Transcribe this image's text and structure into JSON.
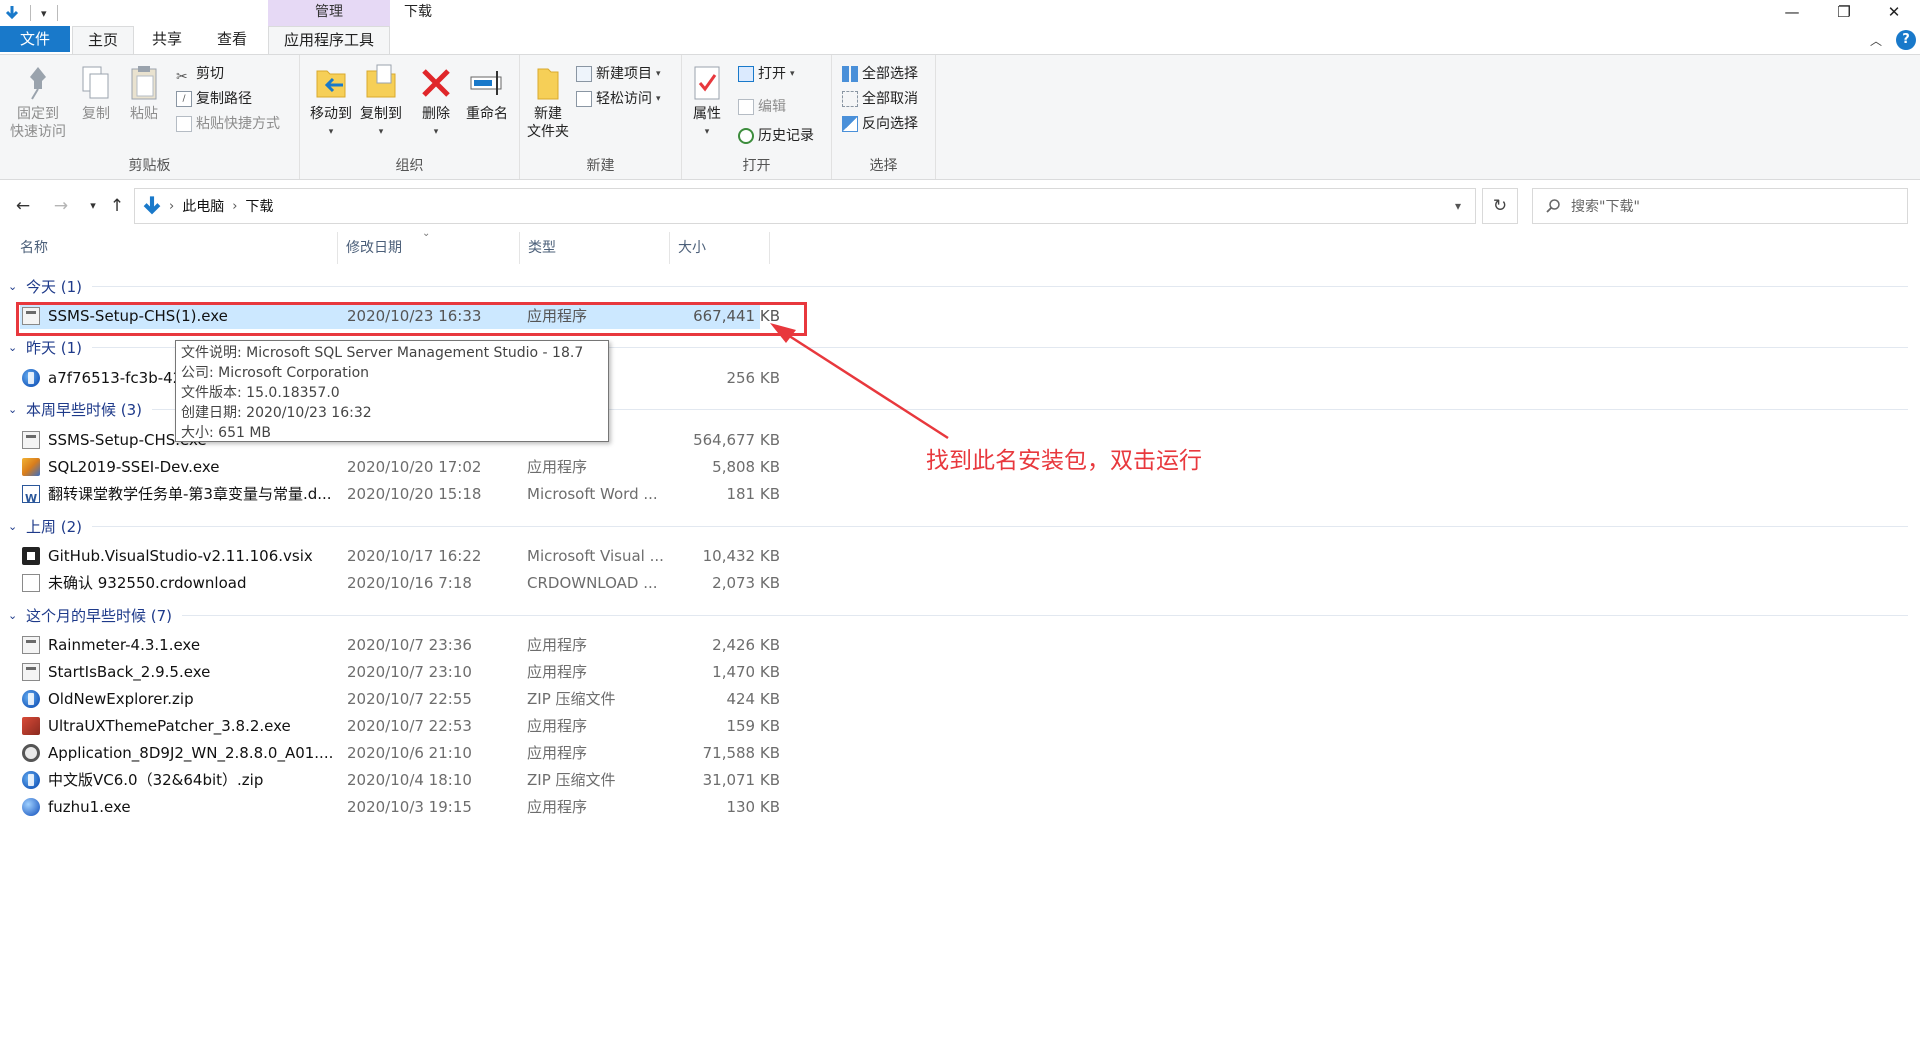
{
  "window": {
    "title": "下载",
    "context_header": "管理",
    "controls": {
      "minimize": "—",
      "maximize": "❐",
      "close": "✕"
    }
  },
  "tabs": {
    "file": "文件",
    "home": "主页",
    "share": "共享",
    "view": "查看",
    "app_tools": "应用程序工具"
  },
  "ribbon": {
    "clipboard": {
      "label": "剪贴板",
      "pin": "固定到快速访问",
      "pin_line1": "固定到",
      "pin_line2": "快速访问",
      "copy": "复制",
      "paste": "粘贴",
      "cut": "剪切",
      "copy_path": "复制路径",
      "paste_shortcut": "粘贴快捷方式"
    },
    "organize": {
      "label": "组织",
      "move_to": "移动到",
      "copy_to": "复制到",
      "delete": "删除",
      "rename": "重命名"
    },
    "new": {
      "label": "新建",
      "new_folder_line1": "新建",
      "new_folder_line2": "文件夹",
      "new_item": "新建项目",
      "easy_access": "轻松访问"
    },
    "open": {
      "label": "打开",
      "properties": "属性",
      "open": "打开",
      "edit": "编辑",
      "history": "历史记录"
    },
    "select": {
      "label": "选择",
      "select_all": "全部选择",
      "select_none": "全部取消",
      "invert": "反向选择"
    }
  },
  "address": {
    "crumbs": [
      "此电脑",
      "下载"
    ],
    "search_placeholder": "搜索\"下载\""
  },
  "columns": {
    "name": "名称",
    "date": "修改日期",
    "type": "类型",
    "size": "大小"
  },
  "groups": [
    {
      "label": "今天 (1)"
    },
    {
      "label": "昨天 (1)"
    },
    {
      "label": "本周早些时候 (3)"
    },
    {
      "label": "上周 (2)"
    },
    {
      "label": "这个月的早些时候 (7)"
    }
  ],
  "files": [
    {
      "name": "SSMS-Setup-CHS(1).exe",
      "date": "2020/10/23 16:33",
      "type": "应用程序",
      "size": "667,441 KB",
      "icon": "exe-installer-icon"
    },
    {
      "name": "a7f76513-fc3b-42",
      "date": "",
      "type": "",
      "size": "256 KB",
      "icon": "zip-archive-icon"
    },
    {
      "name": "SSMS-Setup-CHS.exe",
      "date": "",
      "type": "",
      "size": "564,677 KB",
      "icon": "exe-installer-icon"
    },
    {
      "name": "SQL2019-SSEI-Dev.exe",
      "date": "2020/10/20 17:02",
      "type": "应用程序",
      "size": "5,808 KB",
      "icon": "sql-installer-icon"
    },
    {
      "name": "翻转课堂教学任务单-第3章变量与常量.d...",
      "date": "2020/10/20 15:18",
      "type": "Microsoft Word ...",
      "size": "181 KB",
      "icon": "word-document-icon"
    },
    {
      "name": "GitHub.VisualStudio-v2.11.106.vsix",
      "date": "2020/10/17 16:22",
      "type": "Microsoft Visual ...",
      "size": "10,432 KB",
      "icon": "vsix-package-icon"
    },
    {
      "name": "未确认 932550.crdownload",
      "date": "2020/10/16 7:18",
      "type": "CRDOWNLOAD ...",
      "size": "2,073 KB",
      "icon": "blank-file-icon"
    },
    {
      "name": "Rainmeter-4.3.1.exe",
      "date": "2020/10/7 23:36",
      "type": "应用程序",
      "size": "2,426 KB",
      "icon": "exe-installer-icon"
    },
    {
      "name": "StartIsBack_2.9.5.exe",
      "date": "2020/10/7 23:10",
      "type": "应用程序",
      "size": "1,470 KB",
      "icon": "exe-installer-icon"
    },
    {
      "name": "OldNewExplorer.zip",
      "date": "2020/10/7 22:55",
      "type": "ZIP 压缩文件",
      "size": "424 KB",
      "icon": "zip-archive-icon"
    },
    {
      "name": "UltraUXThemePatcher_3.8.2.exe",
      "date": "2020/10/7 22:53",
      "type": "应用程序",
      "size": "159 KB",
      "icon": "patcher-exe-icon"
    },
    {
      "name": "Application_8D9J2_WN_2.8.8.0_A01....",
      "date": "2020/10/6 21:10",
      "type": "应用程序",
      "size": "71,588 KB",
      "icon": "setup-gear-icon"
    },
    {
      "name": "中文版VC6.0（32&64bit）.zip",
      "date": "2020/10/4 18:10",
      "type": "ZIP 压缩文件",
      "size": "31,071 KB",
      "icon": "zip-archive-icon"
    },
    {
      "name": "fuzhu1.exe",
      "date": "2020/10/3 19:15",
      "type": "应用程序",
      "size": "130 KB",
      "icon": "globe-exe-icon"
    }
  ],
  "tooltip": {
    "description": "文件说明: Microsoft SQL Server Management Studio - 18.7",
    "company": "公司: Microsoft Corporation",
    "version": "文件版本: 15.0.18357.0",
    "created": "创建日期: 2020/10/23 16:32",
    "size": "大小: 651 MB"
  },
  "annotation": {
    "text": "找到此名安装包，双击运行",
    "color": "#e8383d"
  },
  "colors": {
    "accent": "#1979ca",
    "selection": "#cce8ff",
    "context_tab": "#e6d9f5",
    "group_header": "#1e3a8a"
  }
}
